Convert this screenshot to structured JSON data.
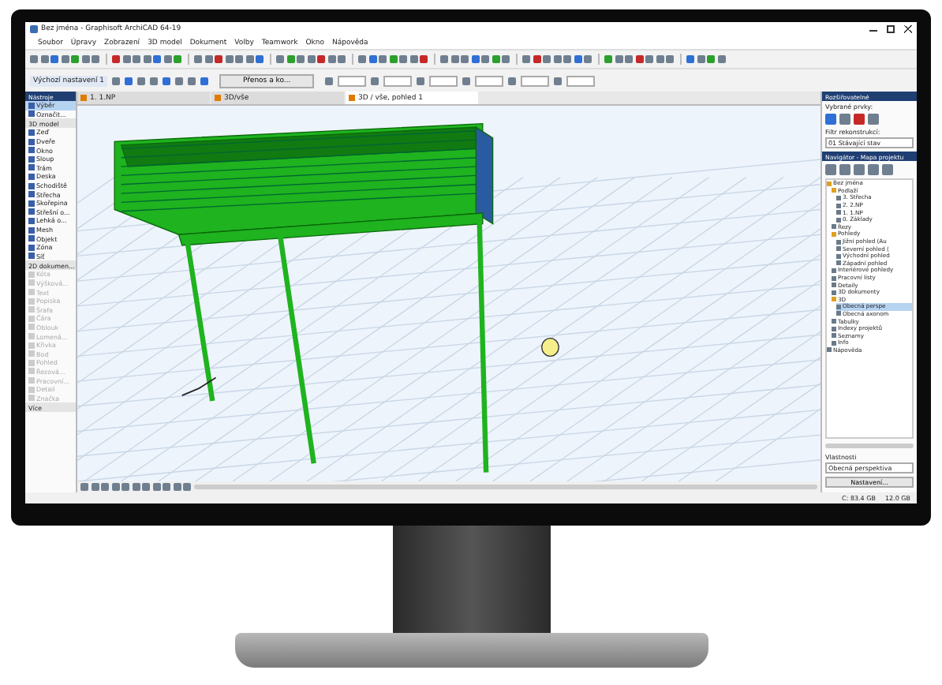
{
  "window": {
    "title": "Bez jména - Graphisoft ArchiCAD 64-19"
  },
  "menu": [
    "Soubor",
    "Úpravy",
    "Zobrazení",
    "3D model",
    "Dokument",
    "Volby",
    "Teamwork",
    "Okno",
    "Nápověda"
  ],
  "info_box": {
    "label": "Výchozí nastavení 1",
    "button": "Přenos a ko..."
  },
  "view_tabs": [
    {
      "label": "1. 1.NP",
      "selected": false
    },
    {
      "label": "3D/vše",
      "selected": false
    },
    {
      "label": "3D / vše, pohled 1",
      "selected": true
    }
  ],
  "toolbox": {
    "title": "Nástroje",
    "items": [
      {
        "kind": "tool",
        "label": "Výběr",
        "selected": true,
        "disabled": false
      },
      {
        "kind": "tool",
        "label": "Označit...",
        "selected": false,
        "disabled": false
      },
      {
        "kind": "section",
        "label": "3D model"
      },
      {
        "kind": "tool",
        "label": "Zeď",
        "selected": false,
        "disabled": false
      },
      {
        "kind": "tool",
        "label": "Dveře",
        "selected": false,
        "disabled": false
      },
      {
        "kind": "tool",
        "label": "Okno",
        "selected": false,
        "disabled": false
      },
      {
        "kind": "tool",
        "label": "Sloup",
        "selected": false,
        "disabled": false
      },
      {
        "kind": "tool",
        "label": "Trám",
        "selected": false,
        "disabled": false
      },
      {
        "kind": "tool",
        "label": "Deska",
        "selected": false,
        "disabled": false
      },
      {
        "kind": "tool",
        "label": "Schodiště",
        "selected": false,
        "disabled": false
      },
      {
        "kind": "tool",
        "label": "Střecha",
        "selected": false,
        "disabled": false
      },
      {
        "kind": "tool",
        "label": "Skořepina",
        "selected": false,
        "disabled": false
      },
      {
        "kind": "tool",
        "label": "Střešní o...",
        "selected": false,
        "disabled": false
      },
      {
        "kind": "tool",
        "label": "Lehká o...",
        "selected": false,
        "disabled": false
      },
      {
        "kind": "tool",
        "label": "Mesh",
        "selected": false,
        "disabled": false
      },
      {
        "kind": "tool",
        "label": "Objekt",
        "selected": false,
        "disabled": false
      },
      {
        "kind": "tool",
        "label": "Zóna",
        "selected": false,
        "disabled": false
      },
      {
        "kind": "tool",
        "label": "Síť",
        "selected": false,
        "disabled": false
      },
      {
        "kind": "section",
        "label": "2D dokumen..."
      },
      {
        "kind": "tool",
        "label": "Kóta",
        "selected": false,
        "disabled": true
      },
      {
        "kind": "tool",
        "label": "Výšková...",
        "selected": false,
        "disabled": true
      },
      {
        "kind": "tool",
        "label": "Text",
        "selected": false,
        "disabled": true
      },
      {
        "kind": "tool",
        "label": "Popiska",
        "selected": false,
        "disabled": true
      },
      {
        "kind": "tool",
        "label": "Šrafa",
        "selected": false,
        "disabled": true
      },
      {
        "kind": "tool",
        "label": "Čára",
        "selected": false,
        "disabled": true
      },
      {
        "kind": "tool",
        "label": "Oblouk",
        "selected": false,
        "disabled": true
      },
      {
        "kind": "tool",
        "label": "Lomená...",
        "selected": false,
        "disabled": true
      },
      {
        "kind": "tool",
        "label": "Křivka",
        "selected": false,
        "disabled": true
      },
      {
        "kind": "tool",
        "label": "Bod",
        "selected": false,
        "disabled": true
      },
      {
        "kind": "tool",
        "label": "Pohled",
        "selected": false,
        "disabled": true
      },
      {
        "kind": "tool",
        "label": "Řezová...",
        "selected": false,
        "disabled": true
      },
      {
        "kind": "tool",
        "label": "Pracovní...",
        "selected": false,
        "disabled": true
      },
      {
        "kind": "tool",
        "label": "Detail",
        "selected": false,
        "disabled": true
      },
      {
        "kind": "tool",
        "label": "Značka",
        "selected": false,
        "disabled": true
      },
      {
        "kind": "section",
        "label": "Více"
      }
    ]
  },
  "organizer": {
    "title": "Rozšiřovatelné",
    "label": "Vybrané prvky:",
    "view_label": "Filtr rekonstrukcí:",
    "view_value": "01 Stávající stav"
  },
  "navigator": {
    "title": "Navigátor - Mapa projektu",
    "tree": [
      {
        "label": "Bez jména",
        "children": [
          {
            "label": "Podlaží",
            "children": [
              {
                "label": "3. Střecha"
              },
              {
                "label": "2. 2.NP"
              },
              {
                "label": "1. 1.NP"
              },
              {
                "label": "0. Základy"
              }
            ]
          },
          {
            "label": "Řezy"
          },
          {
            "label": "Pohledy",
            "children": [
              {
                "label": "Jižní pohled (Au"
              },
              {
                "label": "Severní pohled ("
              },
              {
                "label": "Východní pohled"
              },
              {
                "label": "Západní pohled"
              }
            ]
          },
          {
            "label": "Interiérové pohledy"
          },
          {
            "label": "Pracovní listy"
          },
          {
            "label": "Detaily"
          },
          {
            "label": "3D dokumenty"
          },
          {
            "label": "3D",
            "children": [
              {
                "label": "Obecná perspe",
                "selected": true
              },
              {
                "label": "Obecná axonom",
                "selected": false
              }
            ]
          },
          {
            "label": "Tabulky"
          },
          {
            "label": "Indexy projektů"
          },
          {
            "label": "Seznamy"
          },
          {
            "label": "Info"
          }
        ]
      },
      {
        "label": "Nápověda"
      }
    ],
    "properties": "Vlastnosti",
    "view_name": "Obecná perspektiva",
    "settings_button": "Nastavení..."
  },
  "status_bar": [
    "C: 83.4 GB",
    "12.0 GB"
  ]
}
